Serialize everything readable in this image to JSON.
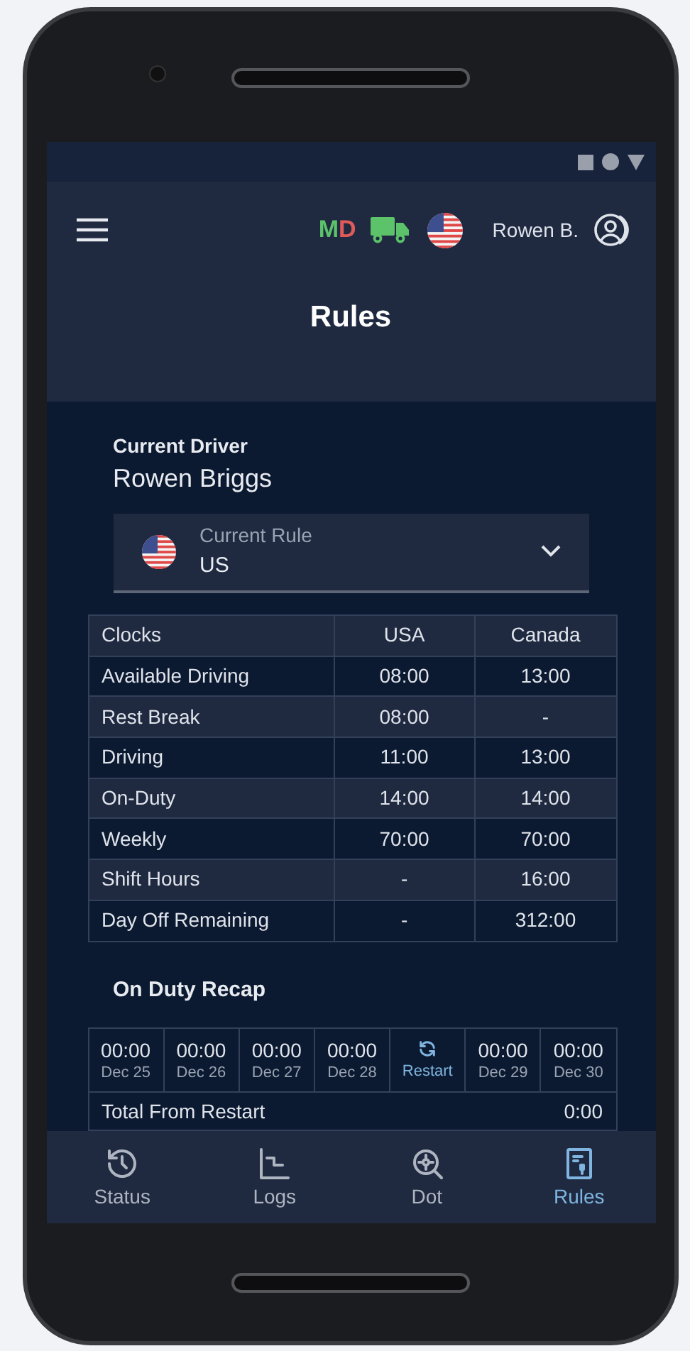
{
  "header": {
    "duty_letters": [
      {
        "text": "M",
        "color": "#5cc36a"
      },
      {
        "text": "D",
        "color": "#e05a5a"
      }
    ],
    "user_name": "Rowen B.",
    "title": "Rules"
  },
  "driver": {
    "label": "Current Driver",
    "name": "Rowen Briggs"
  },
  "rule_select": {
    "label": "Current Rule",
    "value": "US"
  },
  "clocks": {
    "columns": [
      "Clocks",
      "USA",
      "Canada"
    ],
    "rows": [
      [
        "Available Driving",
        "08:00",
        "13:00"
      ],
      [
        "Rest Break",
        "08:00",
        "-"
      ],
      [
        "Driving",
        "11:00",
        "13:00"
      ],
      [
        "On-Duty",
        "14:00",
        "14:00"
      ],
      [
        "Weekly",
        "70:00",
        "70:00"
      ],
      [
        "Shift Hours",
        "-",
        "16:00"
      ],
      [
        "Day Off Remaining",
        "-",
        "312:00"
      ]
    ]
  },
  "recap": {
    "title": "On Duty Recap",
    "days": [
      {
        "kind": "day",
        "time": "00:00",
        "date": "Dec 25"
      },
      {
        "kind": "day",
        "time": "00:00",
        "date": "Dec 26"
      },
      {
        "kind": "day",
        "time": "00:00",
        "date": "Dec 27"
      },
      {
        "kind": "day",
        "time": "00:00",
        "date": "Dec 28"
      },
      {
        "kind": "restart",
        "label": "Restart"
      },
      {
        "kind": "day",
        "time": "00:00",
        "date": "Dec 29"
      },
      {
        "kind": "day",
        "time": "00:00",
        "date": "Dec 30"
      }
    ],
    "total": {
      "label": "Total From Restart",
      "value": "0:00"
    }
  },
  "nav": [
    {
      "label": "Status",
      "selected": false
    },
    {
      "label": "Logs",
      "selected": false
    },
    {
      "label": "Dot",
      "selected": false
    },
    {
      "label": "Rules",
      "selected": true
    }
  ]
}
